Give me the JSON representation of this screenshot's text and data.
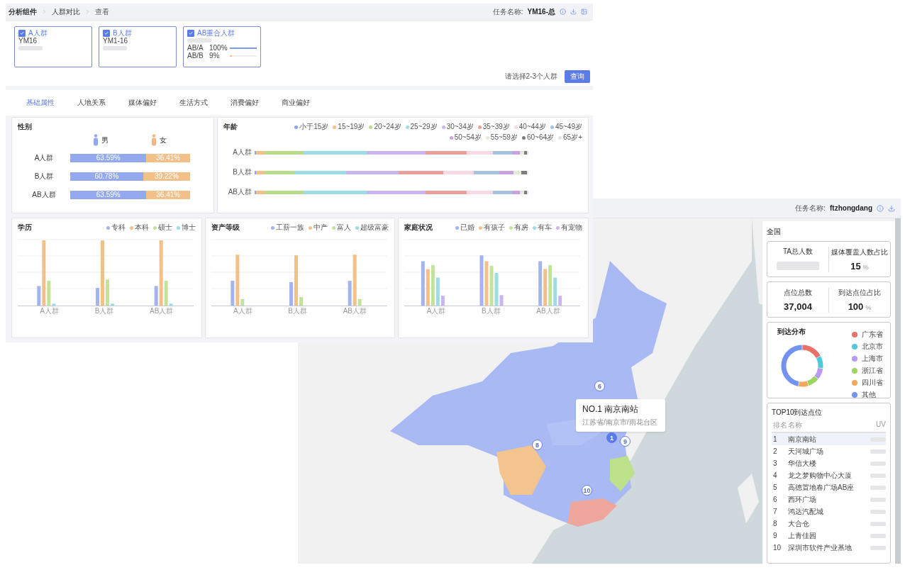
{
  "analysis": {
    "breadcrumb": [
      "分析组件",
      "人群对比",
      "查看"
    ],
    "task_label": "任务名称:",
    "task_name": "YM16-总",
    "groups": [
      {
        "name": "A人群",
        "code": "YM16",
        "checked": true
      },
      {
        "name": "B人群",
        "code": "YM1-16",
        "checked": true
      },
      {
        "name": "AB重合人群",
        "checked": true,
        "ratios": [
          {
            "label": "AB/A",
            "value": "100%",
            "level": 1.0
          },
          {
            "label": "AB/B",
            "value": "9%",
            "level": 0.09
          }
        ]
      }
    ],
    "hint": "请选择2-3个人群",
    "query_button": "查询",
    "tabs": [
      {
        "label": "基础属性",
        "selected": true
      },
      {
        "label": "人地关系",
        "selected": false
      },
      {
        "label": "媒体偏好",
        "selected": false
      },
      {
        "label": "生活方式",
        "selected": false
      },
      {
        "label": "消费偏好",
        "selected": false
      },
      {
        "label": "商业偏好",
        "selected": false
      }
    ],
    "gender": {
      "title": "性别",
      "male": "男",
      "female": "女",
      "rows": [
        {
          "name": "A人群",
          "male": "63.59%",
          "female": "36.41%",
          "level": 0.6359
        },
        {
          "name": "B人群",
          "male": "60.78%",
          "female": "39.22%",
          "level": 0.6078
        },
        {
          "name": "AB人群",
          "male": "63.59%",
          "female": "36.41%",
          "level": 0.6359
        }
      ]
    },
    "age": {
      "title": "年龄",
      "legend": [
        {
          "label": "小于15岁",
          "color": "#8fa6ee"
        },
        {
          "label": "15~19岁",
          "color": "#f3c08a"
        },
        {
          "label": "20~24岁",
          "color": "#b9dc8b"
        },
        {
          "label": "25~29岁",
          "color": "#9ddde6"
        },
        {
          "label": "30~34岁",
          "color": "#c9b5f0"
        },
        {
          "label": "35~39岁",
          "color": "#e9a09a"
        },
        {
          "label": "40~44岁",
          "color": "#f7d9e3"
        },
        {
          "label": "45~49岁",
          "color": "#a6c2dd"
        },
        {
          "label": "50~54岁",
          "color": "#c9a3e0"
        },
        {
          "label": "55~59岁",
          "color": "#e2ecd6"
        },
        {
          "label": "60~64岁",
          "color": "#7d7d7d"
        },
        {
          "label": "65岁+",
          "color": "#e4e4e4"
        }
      ],
      "rows": [
        "A人群",
        "B人群",
        "AB人群"
      ]
    },
    "bar_charts": [
      {
        "title": "学历",
        "legend": [
          {
            "label": "专科",
            "color": "#a3b4f0"
          },
          {
            "label": "本科",
            "color": "#f3c08a"
          },
          {
            "label": "硕士",
            "color": "#c3e39a"
          },
          {
            "label": "博士",
            "color": "#9ddde6"
          }
        ],
        "categories": [
          "A人群",
          "B人群",
          "AB人群"
        ]
      },
      {
        "title": "资产等级",
        "legend": [
          {
            "label": "工薪一族",
            "color": "#a3b4f0"
          },
          {
            "label": "中产",
            "color": "#f3c08a"
          },
          {
            "label": "富人",
            "color": "#c3e39a"
          },
          {
            "label": "超级富豪",
            "color": "#9ddde6"
          }
        ],
        "categories": [
          "A人群",
          "B人群",
          "AB人群"
        ]
      },
      {
        "title": "家庭状况",
        "legend": [
          {
            "label": "已婚",
            "color": "#a3b4f0"
          },
          {
            "label": "有孩子",
            "color": "#f3c08a"
          },
          {
            "label": "有房",
            "color": "#c3e39a"
          },
          {
            "label": "有车",
            "color": "#9ddde6"
          },
          {
            "label": "有宠物",
            "color": "#c9b5f0"
          }
        ],
        "categories": [
          "A人群",
          "B人群",
          "AB人群"
        ]
      }
    ]
  },
  "arrival": {
    "task_label": "任务名称:",
    "task_name": "ftzhongdang",
    "map": {
      "kind": "picture",
      "markers": [
        {
          "label": "6",
          "selected": false
        },
        {
          "label": "1",
          "selected": true
        },
        {
          "label": "9",
          "selected": false
        },
        {
          "label": "8",
          "selected": false
        },
        {
          "label": "10",
          "selected": false
        }
      ],
      "tooltip": {
        "title": "NO.1 南京南站",
        "address": "江苏省/南京市/雨花台区"
      }
    },
    "panel": {
      "title": "全国",
      "stats": [
        [
          {
            "label": "TA总人数"
          },
          {
            "label": "媒体覆盖人数占比",
            "value": "15",
            "unit": "%"
          }
        ],
        [
          {
            "label": "点位总数",
            "value": "37,004"
          },
          {
            "label": "到达点位占比",
            "value": "100",
            "unit": "%"
          }
        ]
      ],
      "distribution": {
        "title": "到达分布",
        "legend": [
          {
            "label": "广东省",
            "color": "#e8726b"
          },
          {
            "label": "北京市",
            "color": "#4fc8dc"
          },
          {
            "label": "上海市",
            "color": "#b99af0"
          },
          {
            "label": "浙江省",
            "color": "#9cd65e"
          },
          {
            "label": "四川省",
            "color": "#f3a95c"
          },
          {
            "label": "其他",
            "color": "#7393f0"
          }
        ]
      },
      "top10": {
        "title": "TOP10到达点位",
        "columns": [
          "排名",
          "名称",
          "UV"
        ],
        "rows": [
          {
            "rank": "1",
            "name": "南京南站",
            "selected": true
          },
          {
            "rank": "2",
            "name": "天河城广场",
            "selected": false
          },
          {
            "rank": "3",
            "name": "华信大楼",
            "selected": false
          },
          {
            "rank": "4",
            "name": "龙之梦购物中心大厦",
            "selected": false
          },
          {
            "rank": "5",
            "name": "高德置地春广场AB座",
            "selected": false
          },
          {
            "rank": "6",
            "name": "西环广场",
            "selected": false
          },
          {
            "rank": "7",
            "name": "鸿达汽配城",
            "selected": false
          },
          {
            "rank": "8",
            "name": "大合仓",
            "selected": false
          },
          {
            "rank": "9",
            "name": "上青佳园",
            "selected": false
          },
          {
            "rank": "10",
            "name": "深圳市软件产业基地",
            "selected": false
          }
        ]
      }
    }
  }
}
